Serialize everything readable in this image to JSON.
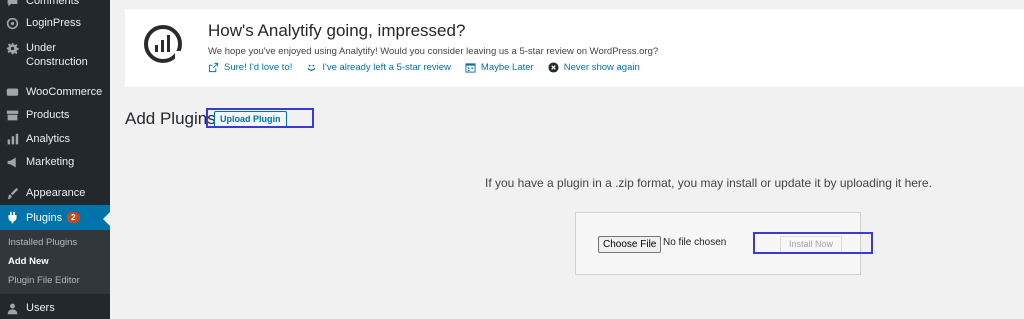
{
  "sidebar": {
    "items": [
      {
        "label": "Comments",
        "icon": "comments-icon"
      },
      {
        "label": "LoginPress",
        "icon": "loginpress-icon"
      },
      {
        "label": "Under Construction",
        "icon": "gear-icon"
      },
      {
        "label": "WooCommerce",
        "icon": "woocommerce-icon"
      },
      {
        "label": "Products",
        "icon": "archive-icon"
      },
      {
        "label": "Analytics",
        "icon": "bar-chart-icon"
      },
      {
        "label": "Marketing",
        "icon": "megaphone-icon"
      },
      {
        "label": "Appearance",
        "icon": "paintbrush-icon"
      },
      {
        "label": "Plugins",
        "icon": "plug-icon",
        "badge": "2"
      },
      {
        "label": "Users",
        "icon": "users-icon"
      }
    ],
    "submenu": [
      "Installed Plugins",
      "Add New",
      "Plugin File Editor"
    ],
    "active_color": "#0073aa",
    "bg_color": "#23282d"
  },
  "notice": {
    "title": "How's Analytify going, impressed?",
    "text": "We hope you've enjoyed using Analytify! Would you consider leaving us a 5-star review on WordPress.org?",
    "links": [
      {
        "label": "Sure! I'd love to!",
        "icon": "external-link-icon"
      },
      {
        "label": "I've already left a 5-star review",
        "icon": "smile-icon"
      },
      {
        "label": "Maybe Later",
        "icon": "calendar-icon"
      },
      {
        "label": "Never show again",
        "icon": "dismiss-icon"
      }
    ]
  },
  "page": {
    "title": "Add Plugins",
    "upload_button": "Upload Plugin",
    "help_text": "If you have a plugin in a .zip format, you may install or update it by uploading it here.",
    "choose_file": "Choose File",
    "file_status": "No file chosen",
    "install_button": "Install Now"
  }
}
